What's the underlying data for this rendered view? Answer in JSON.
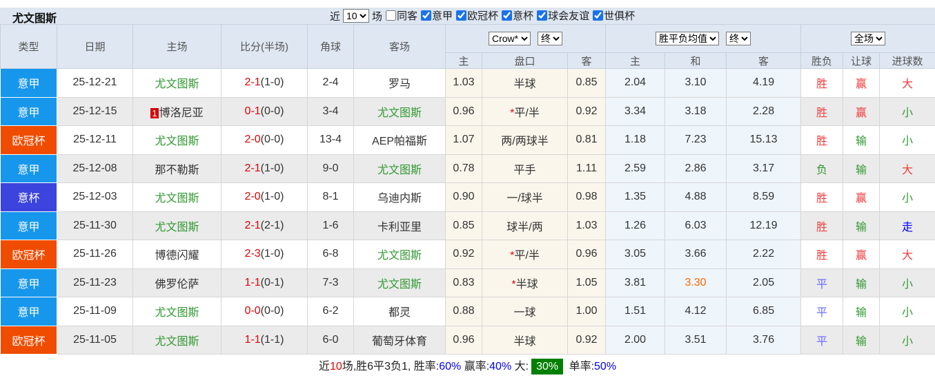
{
  "title": "尤文图斯",
  "filter_bar": {
    "recent_label": "近",
    "recent_value": "10",
    "matches_label": "场",
    "checkboxes": [
      {
        "label": "同客",
        "checked": false
      },
      {
        "label": "意甲",
        "checked": true
      },
      {
        "label": "欧冠杯",
        "checked": true
      },
      {
        "label": "意杯",
        "checked": true
      },
      {
        "label": "球会友谊",
        "checked": true
      },
      {
        "label": "世俱杯",
        "checked": true
      }
    ]
  },
  "table": {
    "headers": {
      "type": "类型",
      "date": "日期",
      "home": "主场",
      "score": "比分(半场)",
      "corner": "角球",
      "away": "客场",
      "odds_home": "主",
      "odds_line": "盘口",
      "odds_away": "客",
      "avg_home": "主",
      "avg_draw": "和",
      "avg_away": "客",
      "wdl": "胜负",
      "handicap": "让球",
      "goals": "进球数"
    },
    "selects": {
      "bookmaker": "Crow*",
      "bookmaker_period": "终",
      "average": "胜平负均值",
      "average_period": "终",
      "scope": "全场"
    },
    "rows": [
      {
        "league": "意甲",
        "date": "25-12-21",
        "rank": "",
        "home": "尤文图斯",
        "home_color": "green",
        "score_ft": "2-1",
        "score_ht": "(1-0)",
        "corner": "2-4",
        "away": "罗马",
        "away_color": "dark",
        "odds_home": "1.03",
        "line_star": "",
        "line": "半球",
        "odds_away": "0.85",
        "avg_home": "2.04",
        "avg_draw": "3.10",
        "avg_away": "4.19",
        "avg_draw_color": "",
        "wdl": "胜",
        "wdl_color": "red",
        "handicap": "赢",
        "handicap_color": "red",
        "goals": "大",
        "goals_color": "red"
      },
      {
        "league": "意甲",
        "date": "25-12-15",
        "rank": "1",
        "home": "博洛尼亚",
        "home_color": "dark",
        "score_ft": "0-1",
        "score_ht": "(0-0)",
        "corner": "3-4",
        "away": "尤文图斯",
        "away_color": "green",
        "odds_home": "0.96",
        "line_star": "*",
        "line": "平/半",
        "odds_away": "0.92",
        "avg_home": "3.34",
        "avg_draw": "3.18",
        "avg_away": "2.28",
        "avg_draw_color": "",
        "wdl": "胜",
        "wdl_color": "red",
        "handicap": "赢",
        "handicap_color": "red",
        "goals": "小",
        "goals_color": "green"
      },
      {
        "league": "欧冠杯",
        "date": "25-12-11",
        "rank": "",
        "home": "尤文图斯",
        "home_color": "green",
        "score_ft": "2-0",
        "score_ht": "(0-0)",
        "corner": "13-4",
        "away": "AEP帕福斯",
        "away_color": "dark",
        "odds_home": "1.07",
        "line_star": "",
        "line": "两/两球半",
        "odds_away": "0.81",
        "avg_home": "1.18",
        "avg_draw": "7.23",
        "avg_away": "15.13",
        "avg_draw_color": "",
        "wdl": "胜",
        "wdl_color": "red",
        "handicap": "输",
        "handicap_color": "green",
        "goals": "小",
        "goals_color": "green"
      },
      {
        "league": "意甲",
        "date": "25-12-08",
        "rank": "",
        "home": "那不勒斯",
        "home_color": "dark",
        "score_ft": "2-1",
        "score_ht": "(1-0)",
        "corner": "9-0",
        "away": "尤文图斯",
        "away_color": "green",
        "odds_home": "0.78",
        "line_star": "",
        "line": "平手",
        "odds_away": "1.11",
        "avg_home": "2.59",
        "avg_draw": "2.86",
        "avg_away": "3.17",
        "avg_draw_color": "",
        "wdl": "负",
        "wdl_color": "green",
        "handicap": "输",
        "handicap_color": "green",
        "goals": "大",
        "goals_color": "red"
      },
      {
        "league": "意杯",
        "date": "25-12-03",
        "rank": "",
        "home": "尤文图斯",
        "home_color": "green",
        "score_ft": "2-0",
        "score_ht": "(1-0)",
        "corner": "8-1",
        "away": "乌迪内斯",
        "away_color": "dark",
        "odds_home": "0.90",
        "line_star": "",
        "line": "一/球半",
        "odds_away": "0.98",
        "avg_home": "1.35",
        "avg_draw": "4.88",
        "avg_away": "8.59",
        "avg_draw_color": "",
        "wdl": "胜",
        "wdl_color": "red",
        "handicap": "赢",
        "handicap_color": "red",
        "goals": "小",
        "goals_color": "green"
      },
      {
        "league": "意甲",
        "date": "25-11-30",
        "rank": "",
        "home": "尤文图斯",
        "home_color": "green",
        "score_ft": "2-1",
        "score_ht": "(2-1)",
        "corner": "1-6",
        "away": "卡利亚里",
        "away_color": "dark",
        "odds_home": "0.85",
        "line_star": "",
        "line": "球半/两",
        "odds_away": "1.03",
        "avg_home": "1.26",
        "avg_draw": "6.03",
        "avg_away": "12.19",
        "avg_draw_color": "",
        "wdl": "胜",
        "wdl_color": "red",
        "handicap": "输",
        "handicap_color": "green",
        "goals": "走",
        "goals_color": "blue"
      },
      {
        "league": "欧冠杯",
        "date": "25-11-26",
        "rank": "",
        "home": "博德闪耀",
        "home_color": "dark",
        "score_ft": "2-3",
        "score_ht": "(1-0)",
        "corner": "6-8",
        "away": "尤文图斯",
        "away_color": "green",
        "odds_home": "0.92",
        "line_star": "*",
        "line": "平/半",
        "odds_away": "0.96",
        "avg_home": "3.05",
        "avg_draw": "3.66",
        "avg_away": "2.22",
        "avg_draw_color": "",
        "wdl": "胜",
        "wdl_color": "red",
        "handicap": "赢",
        "handicap_color": "red",
        "goals": "大",
        "goals_color": "red"
      },
      {
        "league": "意甲",
        "date": "25-11-23",
        "rank": "",
        "home": "佛罗伦萨",
        "home_color": "dark",
        "score_ft": "1-1",
        "score_ht": "(0-1)",
        "corner": "7-3",
        "away": "尤文图斯",
        "away_color": "green",
        "odds_home": "0.83",
        "line_star": "*",
        "line": "半球",
        "odds_away": "1.05",
        "avg_home": "3.81",
        "avg_draw": "3.30",
        "avg_away": "2.05",
        "avg_draw_color": "orange",
        "wdl": "平",
        "wdl_color": "purple",
        "handicap": "输",
        "handicap_color": "green",
        "goals": "小",
        "goals_color": "green"
      },
      {
        "league": "意甲",
        "date": "25-11-09",
        "rank": "",
        "home": "尤文图斯",
        "home_color": "green",
        "score_ft": "0-0",
        "score_ht": "(0-0)",
        "corner": "6-2",
        "away": "都灵",
        "away_color": "dark",
        "odds_home": "0.88",
        "line_star": "",
        "line": "一球",
        "odds_away": "1.00",
        "avg_home": "1.51",
        "avg_draw": "4.12",
        "avg_away": "6.85",
        "avg_draw_color": "",
        "wdl": "平",
        "wdl_color": "purple",
        "handicap": "输",
        "handicap_color": "green",
        "goals": "小",
        "goals_color": "green"
      },
      {
        "league": "欧冠杯",
        "date": "25-11-05",
        "rank": "",
        "home": "尤文图斯",
        "home_color": "green",
        "score_ft": "1-1",
        "score_ht": "(1-1)",
        "corner": "6-0",
        "away": "葡萄牙体育",
        "away_color": "dark",
        "odds_home": "0.96",
        "line_star": "",
        "line": "半球",
        "odds_away": "0.92",
        "avg_home": "2.00",
        "avg_draw": "3.51",
        "avg_away": "3.76",
        "avg_draw_color": "",
        "wdl": "平",
        "wdl_color": "purple",
        "handicap": "输",
        "handicap_color": "green",
        "goals": "小",
        "goals_color": "green"
      }
    ]
  },
  "summary": {
    "prefix": "近",
    "count": "10",
    "record": "场,胜6平3负1, 胜率:",
    "win_rate": "60%",
    "handicap_label": " 赢率:",
    "handicap_rate": "40%",
    "big_label": " 大:",
    "big_rate": "30%",
    "single_label": " 单率:",
    "single_rate": "50%"
  },
  "colors": {
    "league": {
      "意甲": "#1797ec",
      "欧冠杯": "#f04c00",
      "意杯": "#3b44dd"
    },
    "checkbox_blue": "#1a73e8",
    "score_red": "#e60000",
    "result_red": "#f23b3b",
    "team_green": "#339933",
    "draw_purple": "#6b6bff",
    "walk_blue": "#0000ff",
    "highlight_orange": "#ff6600",
    "summary_rate_blue": "#0000ff",
    "summary_big_bg": "#008000",
    "header_bg": "#dee7f2",
    "stripe_gray": "#ebebeb",
    "odds_cream_bg": "#fbf6ec",
    "avg_blue_bg": "#eef5fb"
  }
}
